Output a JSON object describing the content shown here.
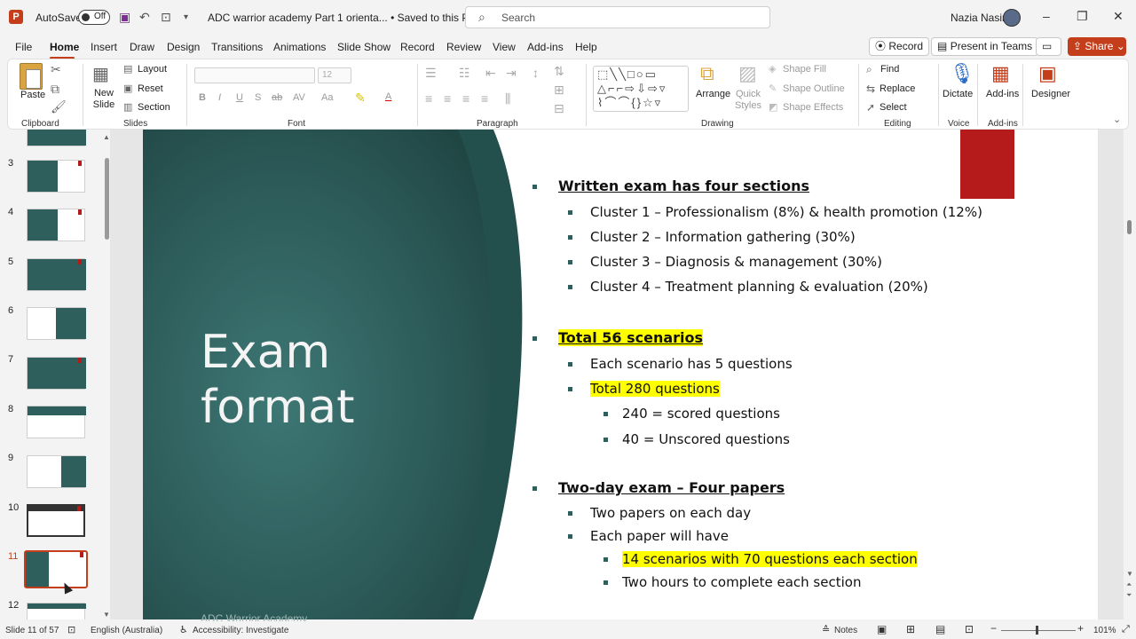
{
  "app": {
    "logo_letter": "P",
    "autosave_label": "AutoSave",
    "autosave_state": "Off",
    "filename": "ADC warrior academy Part 1 orienta...",
    "save_status": "• Saved to this PC",
    "user_name": "Nazia Nasir",
    "search_placeholder": "Search"
  },
  "window": {
    "minimize": "–",
    "restore": "❐",
    "close": "✕"
  },
  "menu": {
    "tabs": [
      "File",
      "Home",
      "Insert",
      "Draw",
      "Design",
      "Transitions",
      "Animations",
      "Slide Show",
      "Record",
      "Review",
      "View",
      "Add-ins",
      "Help"
    ],
    "active": "Home",
    "record_btn": "Record",
    "present_btn": "Present in Teams",
    "share_btn": "Share"
  },
  "ribbon": {
    "clipboard": {
      "paste": "Paste",
      "group": "Clipboard"
    },
    "slides": {
      "new_slide": "New Slide",
      "layout": "Layout",
      "reset": "Reset",
      "section": "Section",
      "group": "Slides"
    },
    "font": {
      "size": "12",
      "group": "Font",
      "bold": "B",
      "italic": "I",
      "underline": "U",
      "shadow": "S",
      "strike": "ab",
      "spacing": "AV",
      "case": "Aa",
      "color_letter": "A"
    },
    "paragraph": {
      "group": "Paragraph"
    },
    "drawing": {
      "arrange": "Arrange",
      "quick_styles": "Quick Styles",
      "shape_fill": "Shape Fill",
      "shape_outline": "Shape Outline",
      "shape_effects": "Shape Effects",
      "group": "Drawing"
    },
    "editing": {
      "find": "Find",
      "replace": "Replace",
      "select": "Select",
      "group": "Editing"
    },
    "voice": {
      "dictate": "Dictate",
      "group": "Voice"
    },
    "addins": {
      "addins": "Add-ins",
      "group": "Add-ins"
    },
    "designer": {
      "label": "Designer"
    }
  },
  "thumbnails": [
    {
      "num": "3",
      "selected": false
    },
    {
      "num": "4",
      "selected": false
    },
    {
      "num": "5",
      "selected": false
    },
    {
      "num": "6",
      "selected": false
    },
    {
      "num": "7",
      "selected": false
    },
    {
      "num": "8",
      "selected": false
    },
    {
      "num": "9",
      "selected": false
    },
    {
      "num": "10",
      "selected": false
    },
    {
      "num": "11",
      "selected": true
    },
    {
      "num": "12",
      "selected": false
    }
  ],
  "slide": {
    "title_line1": "Exam",
    "title_line2": "format",
    "footer": "ADC Warrior Academy",
    "bullets": [
      {
        "level": 1,
        "text": "Written exam has four sections",
        "highlight": false
      },
      {
        "level": 2,
        "text": "Cluster 1 – Professionalism (8%) & health promotion (12%)",
        "highlight": false
      },
      {
        "level": 2,
        "text": "Cluster 2 – Information gathering (30%)",
        "highlight": false
      },
      {
        "level": 2,
        "text": "Cluster 3 – Diagnosis & management (30%)",
        "highlight": false
      },
      {
        "level": 2,
        "text": "Cluster 4 – Treatment planning & evaluation (20%)",
        "highlight": false
      },
      {
        "level": 1,
        "text": "Total 56 scenarios",
        "highlight": true
      },
      {
        "level": 2,
        "text": "Each scenario has 5 questions",
        "highlight": false
      },
      {
        "level": 2,
        "text": "Total 280 questions",
        "highlight": true
      },
      {
        "level": 3,
        "text": "240 = scored questions",
        "highlight": false
      },
      {
        "level": 3,
        "text": "40 = Unscored questions",
        "highlight": false
      },
      {
        "level": 1,
        "text": "Two-day exam – Four papers",
        "highlight": false
      },
      {
        "level": 2,
        "text": "Two papers on each day",
        "highlight": false
      },
      {
        "level": 2,
        "text": "Each paper will have",
        "highlight": false
      },
      {
        "level": 3,
        "text": "14 scenarios with 70 questions each section",
        "highlight": true
      },
      {
        "level": 3,
        "text": "Two hours to complete each section",
        "highlight": false
      }
    ]
  },
  "status": {
    "slide_counter": "Slide 11 of 57",
    "language": "English (Australia)",
    "accessibility": "Accessibility: Investigate",
    "notes": "Notes",
    "zoom": "101%"
  },
  "colors": {
    "accent": "#c43e1c",
    "slide_teal": "#2f5f5d",
    "highlight": "#ffff00",
    "red_box": "#b51b1b"
  }
}
